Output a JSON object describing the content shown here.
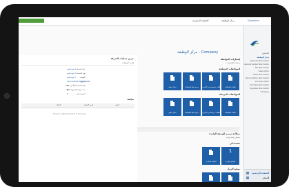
{
  "topbar": {
    "item1": "الصفحة الرئيسية",
    "item2": "مركز الوظيفة",
    "brand": "Dynamics"
  },
  "nav": {
    "section_label": "المحتوى",
    "items": [
      "مركز الوظيفة",
      "Approval Role Center",
      "General Ledger Role Center",
      "Tax Role Center",
      "Sales Order",
      "Sales Role Center",
      "Reconciliation Role Center",
      "Purchase Order",
      "Purchase Role Center",
      "Payables Role Center",
      "Company"
    ],
    "bottom_items": [
      "الصفحة الرئيسية",
      "المتجر"
    ]
  },
  "page": {
    "title": "مركز الوظيفة - Company"
  },
  "left_panel": {
    "header": "عرض عمليات الشركة",
    "sub": "قائمة العمليات",
    "fields": [
      {
        "key": "رقم الحساب",
        "value": "لا توجد قيم"
      },
      {
        "key": "نوع المستند",
        "value": "لا توجد قيم"
      },
      {
        "key": "الوصف",
        "value": "لا توجد قيم"
      },
      {
        "key": "التاريخ",
        "value": "12/31/2015-01/01/2009"
      },
      {
        "key": "المستندات المتأخرة فقط",
        "value": "0"
      },
      {
        "key": "عدد مرات التسوية الكلية",
        "value": "0"
      },
      {
        "key": "لا توجد قيم",
        "value": "0"
      }
    ],
    "grid_header": "متابعة",
    "columns": [
      "الرقم",
      "تاريخ الإنشاء",
      "الحالة"
    ],
    "empty_text": "There is nothing to show in the view."
  },
  "sections": {
    "s1_title": "إشعارات المواصلة",
    "s1_sub": "سجلات الإشعارات",
    "s2_title": "الموافقات المتعلقة",
    "s3_title": "الموافقات المرسلة",
    "s4_title": "مطالبة ترميم الوثيقة الواردة",
    "s4_sub": "تسجيل وثيقة واردة",
    "s5_title": "مستنداتي",
    "s6_title": "موقع الزوار"
  },
  "tiles_row1": [
    {
      "num": "0",
      "cap": "طلبات الموافقة"
    },
    {
      "num": "0",
      "cap": "طلبات مرفوضة من الآخرين"
    },
    {
      "num": "0",
      "cap": "مرجع عليه للموافقة"
    },
    {
      "num": "0",
      "cap": "مجال مغلق"
    }
  ],
  "tiles_row2": [
    {
      "num": "0",
      "cap": "طلبات الموافقة"
    },
    {
      "num": "0",
      "cap": "طلبات مرسلة من الآخرين"
    },
    {
      "num": "0",
      "cap": "مرجع عليه للموافقة"
    },
    {
      "num": "0",
      "cap": "مجال مغلق"
    }
  ],
  "tiles_row3": [
    {
      "num": "1",
      "cap": "الوثائق الواردة"
    },
    {
      "num": "0",
      "cap": "الوثائق الصادرة"
    }
  ],
  "colors": {
    "accent": "#1e5fa8",
    "green": "#4f9e3a",
    "bezel": "#141414"
  }
}
